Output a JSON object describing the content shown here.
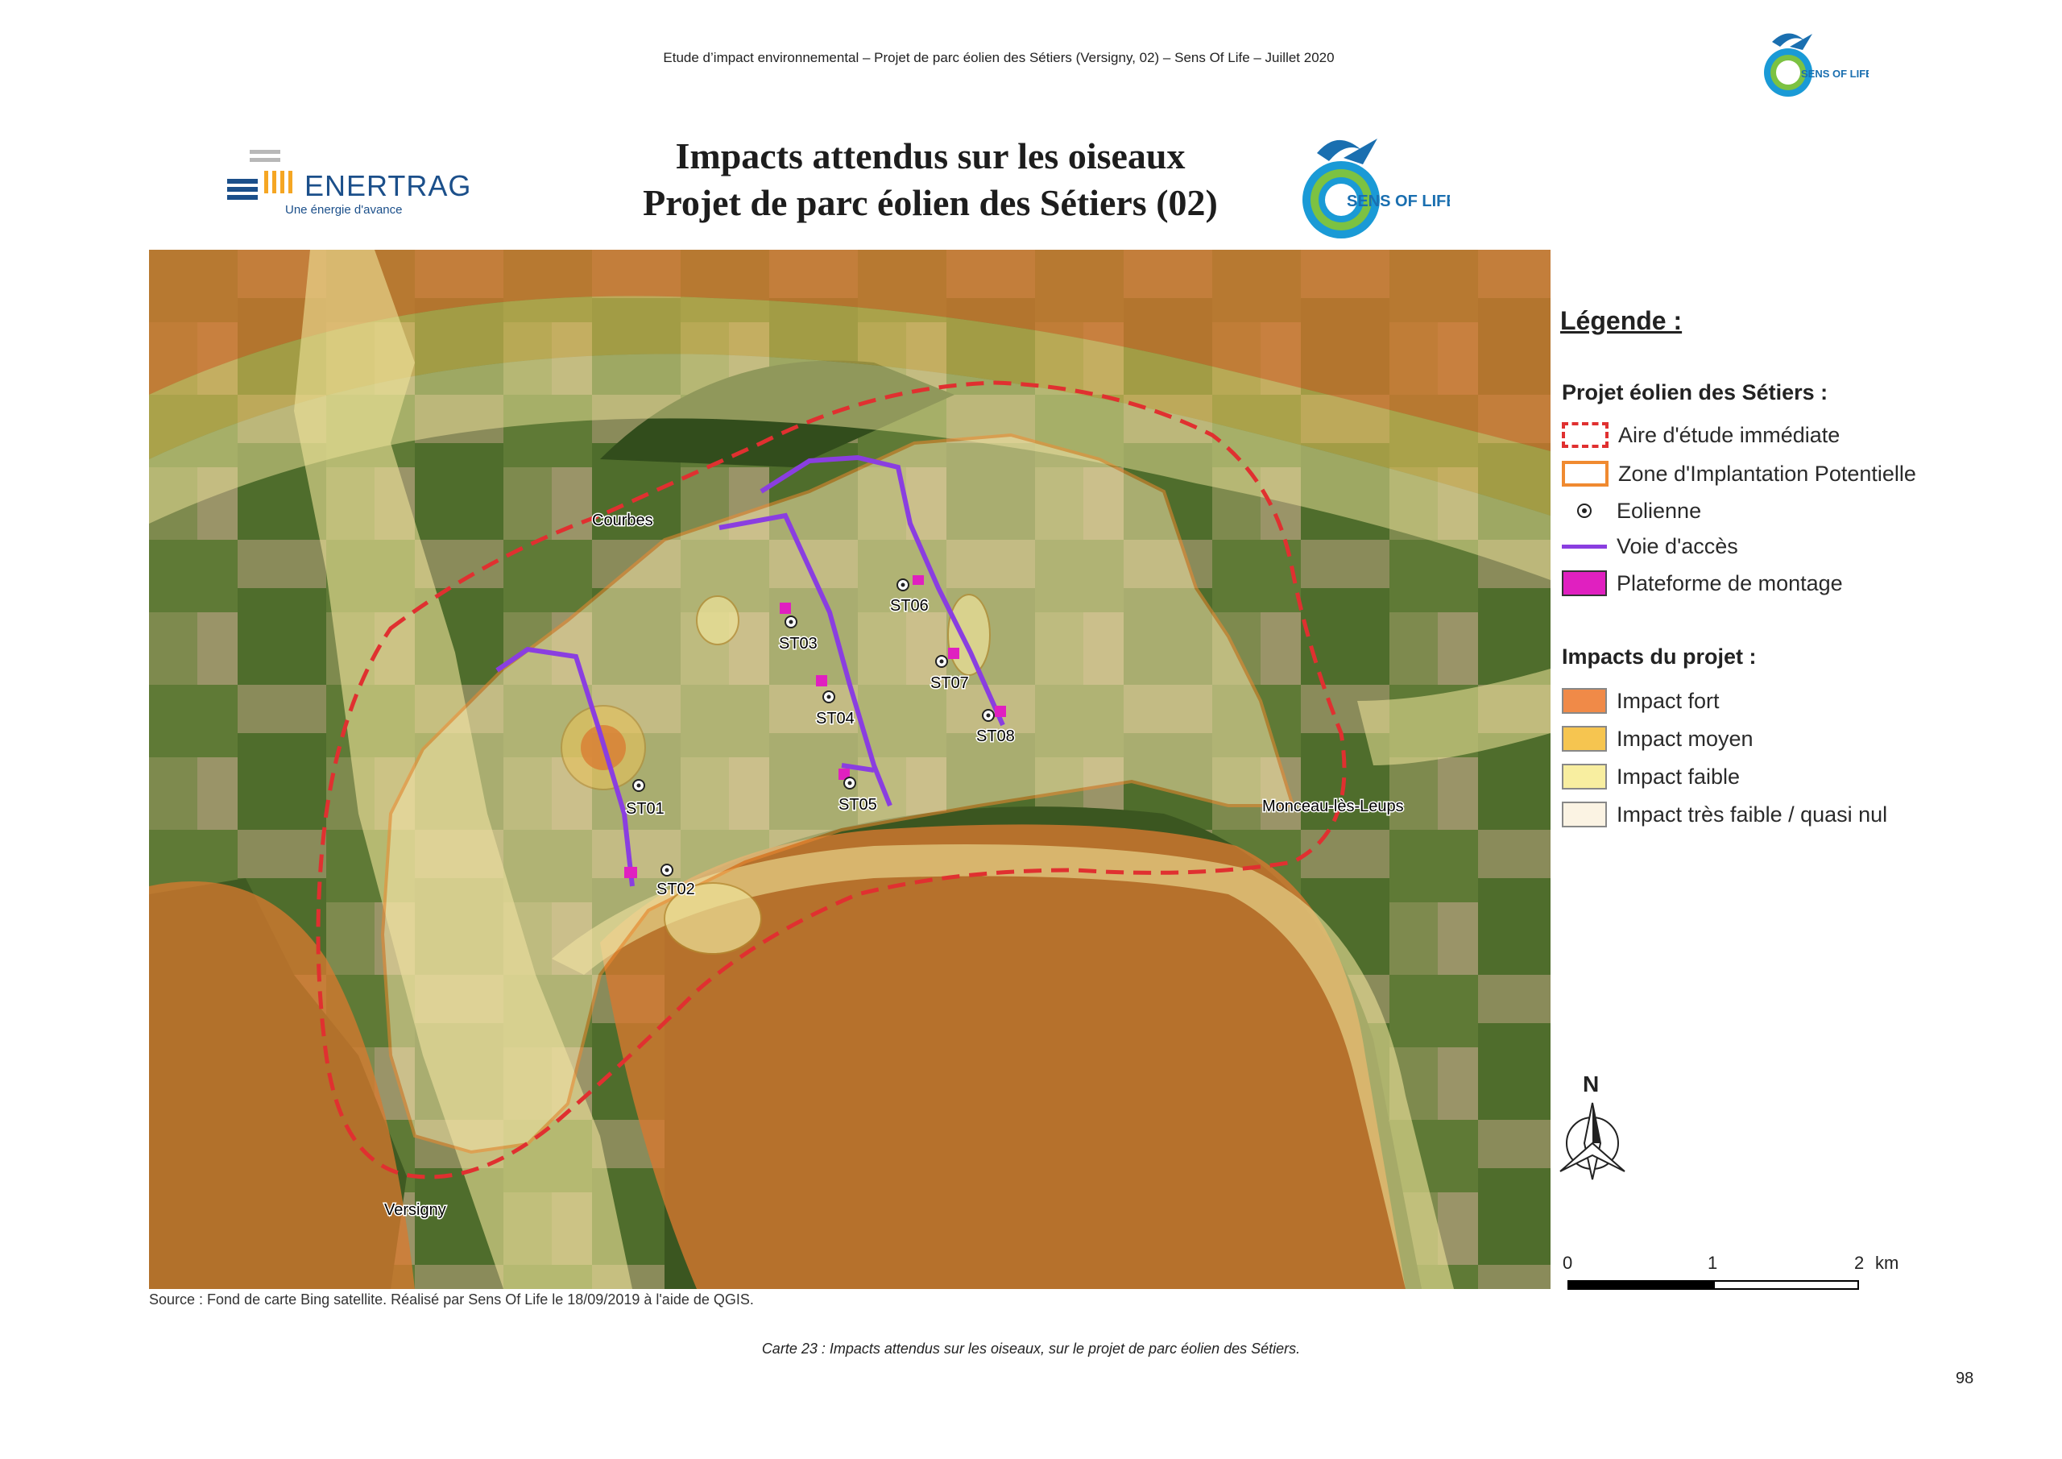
{
  "header": {
    "text": "Etude d’impact environnemental – Projet de parc éolien des Sétiers (Versigny, 02) – Sens Of Life – Juillet 2020"
  },
  "top_logo": {
    "text": "SENS OF LIFE"
  },
  "frame": {
    "title_line1": "Impacts attendus sur les oiseaux",
    "title_line2": "Projet de parc éolien des Sétiers (02)",
    "enertrag_brand": "ENERTRAG",
    "enertrag_tagline": "Une énergie d'avance",
    "sol_brand": "SENS OF LIFE"
  },
  "map": {
    "places": {
      "courbes": "Courbes",
      "monceau": "Monceau-lès-Leups",
      "versigny": "Versigny"
    },
    "turbines": [
      "ST01",
      "ST02",
      "ST03",
      "ST04",
      "ST05",
      "ST06",
      "ST07",
      "ST08"
    ]
  },
  "legend": {
    "title": "Légende :",
    "section_project": "Projet éolien des Sétiers :",
    "items_project": [
      {
        "label": "Aire d'étude immédiate",
        "icon": "red-dashed-rectangle"
      },
      {
        "label": "Zone d'Implantation Potentielle",
        "icon": "orange-outline-rectangle"
      },
      {
        "label": "Eolienne",
        "icon": "turbine-point-icon"
      },
      {
        "label": "Voie d'accès",
        "icon": "purple-line"
      },
      {
        "label": "Plateforme de montage",
        "icon": "magenta-fill"
      }
    ],
    "section_impacts": "Impacts du projet :",
    "items_impacts": [
      {
        "label": "Impact fort",
        "color": "#f08a48"
      },
      {
        "label": "Impact moyen",
        "color": "#f6c550"
      },
      {
        "label": "Impact faible",
        "color": "#f8eea0"
      },
      {
        "label": "Impact très faible / quasi nul",
        "color": "#fbf3e3"
      }
    ]
  },
  "north": {
    "label": "N"
  },
  "scale": {
    "labels": [
      "0",
      "1",
      "2",
      "km"
    ]
  },
  "source": "Source : Fond de carte Bing satellite. Réalisé par Sens Of Life le 18/09/2019 à l'aide de QGIS.",
  "caption": "Carte 23 : Impacts attendus sur les oiseaux, sur le projet de parc éolien des Sétiers.",
  "page_number": "98",
  "colors": {
    "aire_etude": "#e03030",
    "zip": "#f08a30",
    "voie": "#8a3ee0",
    "plateforme": "#e020c0"
  }
}
